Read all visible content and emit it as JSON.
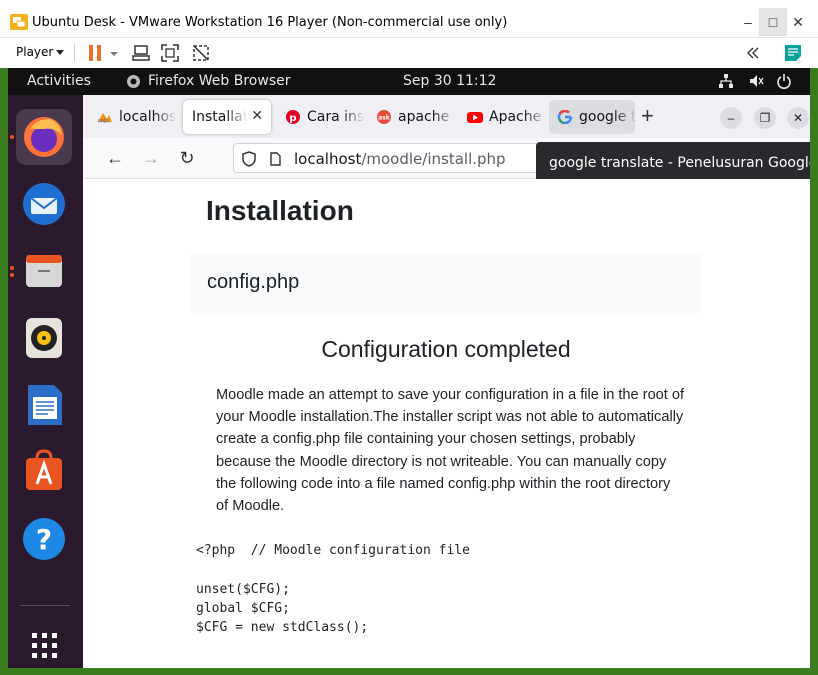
{
  "vmware": {
    "title": "Ubuntu Desk - VMware Workstation 16 Player (Non-commercial use only)",
    "menu_label": "Player",
    "controls": {
      "minimize": "–",
      "maximize": "□",
      "close": "✕"
    },
    "colors": {
      "pause": "#e8732a",
      "accent": "#00a39b"
    }
  },
  "ubuntu": {
    "activities": "Activities",
    "app_name": "Firefox Web Browser",
    "clock": "Sep 30  11:12",
    "dock_items": [
      "Firefox",
      "Thunderbird",
      "Files",
      "Rhythmbox",
      "LibreOffice Writer",
      "Ubuntu Software",
      "Help",
      "Show Applications"
    ]
  },
  "firefox": {
    "tabs": [
      {
        "label": "localhost",
        "icon": "phpmyadmin-icon"
      },
      {
        "label": "Installation",
        "icon": "none",
        "selected": true
      },
      {
        "label": "Cara install",
        "icon": "pinterest-icon"
      },
      {
        "label": "apache",
        "icon": "ask-icon"
      },
      {
        "label": "Apache",
        "icon": "youtube-icon"
      },
      {
        "label": "google translate",
        "icon": "google-icon",
        "hovered": true
      }
    ],
    "url": {
      "host": "localhost",
      "path": "/moodle/install.php"
    },
    "tooltip": "google translate - Penelusuran Google"
  },
  "page": {
    "heading": "Installation",
    "box_title": "config.php",
    "subheading": "Configuration completed",
    "paragraph": "Moodle made an attempt to save your configuration in a file in the root of your Moodle installation.The installer script was not able to automatically create a config.php file containing your chosen settings, probably because the Moodle directory is not writeable. You can manually copy the following code into a file named config.php within the root directory of Moodle.",
    "code": "<?php  // Moodle configuration file\n\nunset($CFG);\nglobal $CFG;\n$CFG = new stdClass();"
  }
}
